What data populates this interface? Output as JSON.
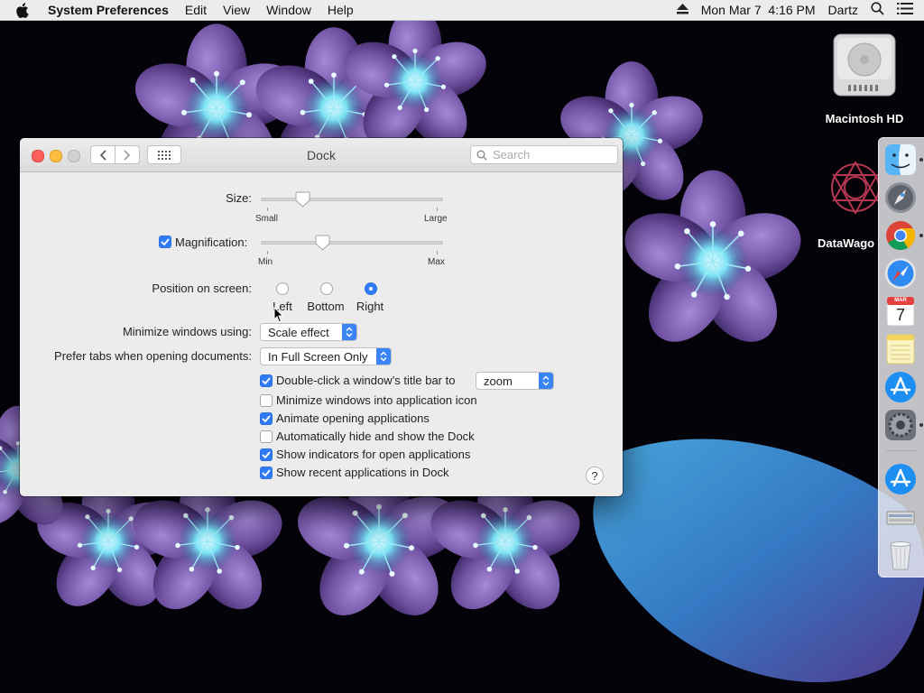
{
  "menubar": {
    "app_name": "System Preferences",
    "menus": [
      "Edit",
      "View",
      "Window",
      "Help"
    ],
    "datetime": "Mon Mar 7  4:16 PM",
    "user": "Dartz",
    "icons": [
      "apple-icon",
      "eject-icon",
      "search-icon",
      "list-icon"
    ]
  },
  "desktop": {
    "icons": [
      {
        "label": "Macintosh HD",
        "icon": "hard-drive-icon"
      },
      {
        "label": "DataWago",
        "icon": "datawago-icon"
      }
    ]
  },
  "window": {
    "title": "Dock",
    "search_placeholder": "Search",
    "size": {
      "label": "Size:",
      "min_label": "Small",
      "max_label": "Large",
      "value_fraction": 0.23
    },
    "magnification": {
      "checked": true,
      "label": "Magnification:",
      "min_label": "Min",
      "max_label": "Max",
      "value_fraction": 0.34
    },
    "position": {
      "label": "Position on screen:",
      "options": [
        "Left",
        "Bottom",
        "Right"
      ],
      "selected": "Right"
    },
    "minimize": {
      "label": "Minimize windows using:",
      "value": "Scale effect"
    },
    "prefer_tabs": {
      "label": "Prefer tabs when opening documents:",
      "value": "In Full Screen Only"
    },
    "double_click": {
      "label": "Double-click a window’s title bar to",
      "checked": true,
      "value": "zoom"
    },
    "checkboxes": [
      {
        "label": "Minimize windows into application icon",
        "checked": false
      },
      {
        "label": "Animate opening applications",
        "checked": true
      },
      {
        "label": "Automatically hide and show the Dock",
        "checked": false
      },
      {
        "label": "Show indicators for open applications",
        "checked": true
      },
      {
        "label": "Show recent applications in Dock",
        "checked": true
      }
    ],
    "help_label": "?"
  },
  "calendar_icon": {
    "month": "MAR",
    "day": "7"
  },
  "colors": {
    "accent": "#2f7bf5",
    "close": "#fc605c",
    "minimize": "#fdbc40"
  }
}
